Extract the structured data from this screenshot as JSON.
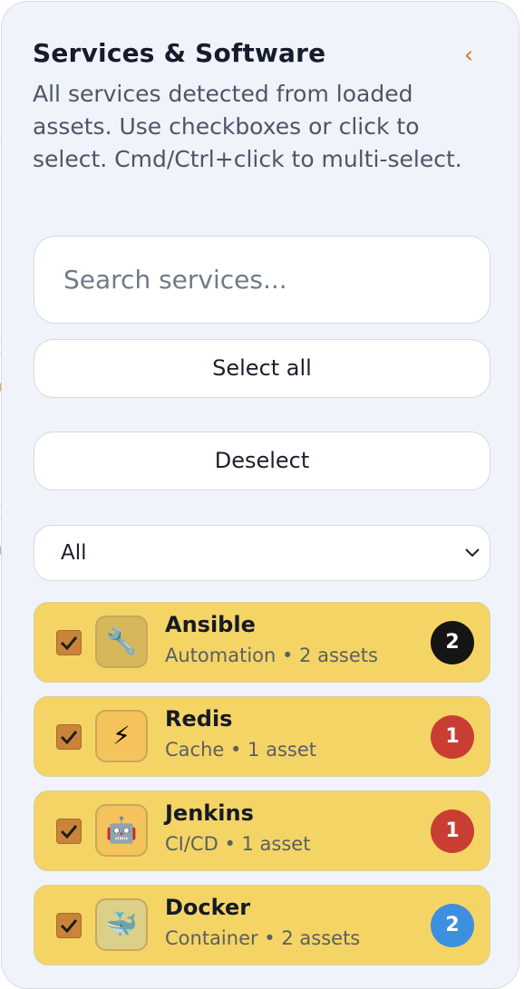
{
  "panel": {
    "title": "Services & Software",
    "collapse_glyph": "‹",
    "description": "All services detected from loaded assets. Use checkboxes or click to select. Cmd/Ctrl+click to multi-select."
  },
  "search": {
    "placeholder": "Search services...",
    "value": ""
  },
  "actions": {
    "select_all_label": "Select all",
    "deselect_label": "Deselect"
  },
  "filter": {
    "selected": "All"
  },
  "services": [
    {
      "name": "Ansible",
      "subtitle": "Automation • 2 assets",
      "count": "2",
      "checked": true,
      "icon": "wrench-icon",
      "glyph": "🔧",
      "icon_bg": "#d6b75c",
      "badge_color": "#151515"
    },
    {
      "name": "Redis",
      "subtitle": "Cache • 1 asset",
      "count": "1",
      "checked": true,
      "icon": "lightning-icon",
      "glyph": "⚡",
      "icon_bg": "#f4c35b",
      "badge_color": "#c93d33"
    },
    {
      "name": "Jenkins",
      "subtitle": "CI/CD • 1 asset",
      "count": "1",
      "checked": true,
      "icon": "robot-icon",
      "glyph": "🤖",
      "icon_bg": "#f4c35b",
      "badge_color": "#c93d33"
    },
    {
      "name": "Docker",
      "subtitle": "Container • 2 assets",
      "count": "2",
      "checked": true,
      "icon": "whale-icon",
      "glyph": "🐳",
      "icon_bg": "#dccf88",
      "badge_color": "#3d8fe0"
    }
  ],
  "colors": {
    "accent": "#cf7a35",
    "item_bg": "#f5d466",
    "panel_bg": "#f0f4fa"
  }
}
